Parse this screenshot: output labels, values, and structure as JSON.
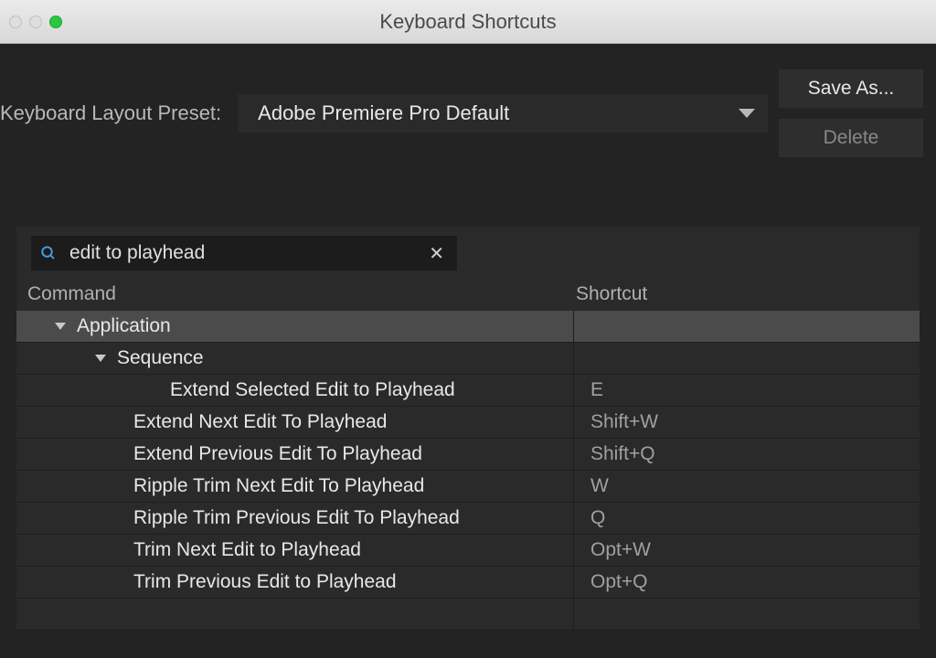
{
  "window": {
    "title": "Keyboard Shortcuts"
  },
  "preset": {
    "label": "Keyboard Layout Preset:",
    "value": "Adobe Premiere Pro Default"
  },
  "buttons": {
    "save_as": "Save As...",
    "delete": "Delete"
  },
  "search": {
    "value": "edit to playhead"
  },
  "table": {
    "header_command": "Command",
    "header_shortcut": "Shortcut",
    "groups": {
      "application": "Application",
      "sequence": "Sequence"
    },
    "rows": [
      {
        "label": "Extend Selected Edit to Playhead",
        "shortcut": "E",
        "indent": "indent-3"
      },
      {
        "label": "Extend Next Edit To Playhead",
        "shortcut": "Shift+W",
        "indent": "indent-2b"
      },
      {
        "label": "Extend Previous Edit To Playhead",
        "shortcut": "Shift+Q",
        "indent": "indent-2b"
      },
      {
        "label": "Ripple Trim Next Edit To Playhead",
        "shortcut": "W",
        "indent": "indent-2b"
      },
      {
        "label": "Ripple Trim Previous Edit To Playhead",
        "shortcut": "Q",
        "indent": "indent-2b"
      },
      {
        "label": "Trim Next Edit to Playhead",
        "shortcut": "Opt+W",
        "indent": "indent-2b"
      },
      {
        "label": "Trim Previous Edit to Playhead",
        "shortcut": "Opt+Q",
        "indent": "indent-2b"
      }
    ]
  }
}
